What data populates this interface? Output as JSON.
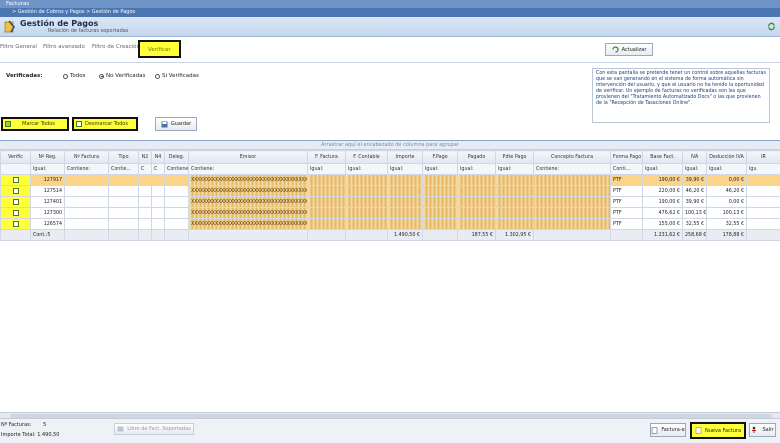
{
  "window": {
    "title": "Facturas"
  },
  "breadcrumb": "> Gestión de Cobros y Pagos  > Gestión de Pagos",
  "header": {
    "title": "Gestión de Pagos",
    "subtitle": "Relación de facturas soportadas"
  },
  "tabs": [
    "Filtro General",
    "Filtro avanzado",
    "Filtro de Creación",
    "Verificar"
  ],
  "actualizar": "Actualizar",
  "verificadas": {
    "label": "Verificadas:",
    "options": [
      "Todos",
      "No Verificadas",
      "Si Verificadas"
    ],
    "selected": "No Verificadas"
  },
  "info_text": "Con esta pantalla se pretende tener un control sobre aquellas facturas que se van generando en el sistema de forma automática sin intervención del usuario, y que el usuario no ha tenido la oportunidad de verificar. Un ejemplo de facturas no verificadas son las que provienen del \"Tratamiento Automatizado Docs\" o las que provienen de la \"Recepción de Tasaciones Online\".",
  "actions": {
    "marcar": "Marcar Todos",
    "desmarcar": "Desmarcar Todos",
    "guardar": "Guardar"
  },
  "grid": {
    "group_panel": "Arrastrar aquí el encabezado de columna para agrupar",
    "columns": [
      "Verific",
      "Nº Reg.",
      "Nº Factura",
      "Tipo",
      "N2",
      "N4",
      "Deleg.",
      "Emisor",
      "F. Factura",
      "F. Contable",
      "Importe",
      "F.Pago",
      "Pagado",
      "Pdte Pago",
      "Concepto Factura",
      "Forma Pago",
      "Base Fact.",
      "IVA",
      "Deducción IVA",
      "IR"
    ],
    "filters": [
      "",
      "Igual:",
      "Contiene:",
      "Contie...",
      "C",
      "C",
      "Contiene:",
      "Contiene:",
      "Igual:",
      "Igual:",
      "Igual:",
      "Igual:",
      "Igual:",
      "Igual:",
      "Contiene:",
      "Conti...",
      "Igual:",
      "Igual:",
      "Igual:",
      "Igu"
    ],
    "rows": [
      {
        "nreg": "127917",
        "emisor": "XXXXXXXXXXXXXXXXXXXXXXXXXXXXXXXXXXXXXXXXXXXXXXXXXXXXXXXXXXXXXXXXXXXXXXXXXXXXXXXXXXXXXXXXXXXXXXXX",
        "forma": "PTF",
        "base": "190,00 €",
        "iva": "39,90 €",
        "ded": "0,00 €"
      },
      {
        "nreg": "127514",
        "emisor": "XXXXXXXXXXXXXXXXXXXXXXXXXXXXXXXXXXXXXXXXXXXXXXXXXXXXXXXXXXXXXXXXXXXXXXXXXXXXXXXXXXXXXXXXXXXXXXXX",
        "forma": "PTF",
        "base": "220,00 €",
        "iva": "46,20 €",
        "ded": "46,20 €"
      },
      {
        "nreg": "127401",
        "emisor": "XXXXXXXXXXXXXXXXXXXXXXXXXXXXXXXXXXXXXXXXXXXXXXXXXXXXXXXXXXXXXXXXXXXXXXXXXXXXXXXXXXXXXXXXXXXXXXXX",
        "forma": "PTF",
        "base": "190,00 €",
        "iva": "39,90 €",
        "ded": "0,00 €"
      },
      {
        "nreg": "127300",
        "emisor": "XXXXXXXXXXXXXXXXXXXXXXXXXXXXXXXXXXXXXXXXXXXXXXXXXXXXXXXXXXXXXXXXXXXXXXXXXXXXXXXXXXXXXXXXXXXXXXXX",
        "forma": "PTF",
        "base": "476,62 €",
        "iva": "100,13 €",
        "ded": "100,13 €"
      },
      {
        "nreg": "126574",
        "emisor": "XXXXXXXXXXXXXXXXXXXXXXXXXXXXXXXXXXXXXXXXXXXXXXXXXXXXXXXXXXXXXXXXXXXXXXXXXXXXXXXXXXXXXXXXXXXXXXXX",
        "forma": "PTF",
        "base": "155,00 €",
        "iva": "32,55 €",
        "ded": "32,55 €"
      }
    ],
    "totals": {
      "count": "Cont.:5",
      "importe": "1.490,50 €",
      "pagado": "187,55 €",
      "pdte": "1.302,95 €",
      "base": "1.231,62 €",
      "iva": "258,68 €",
      "ded": "178,88 €"
    }
  },
  "status": {
    "facturas_label": "Nº Facturas:",
    "facturas": "5",
    "importe_label": "Importe Total:",
    "importe": "1.490,50"
  },
  "footer": {
    "libro": "Libro de Fact. Soportadas",
    "factura_e": "Factura-e",
    "nueva": "Nueva Factura",
    "salir": "Salir"
  },
  "colors": {
    "highlight": "#ffff3a",
    "selected_row": "#fbd48a",
    "header_blue": "#4a76b3"
  }
}
